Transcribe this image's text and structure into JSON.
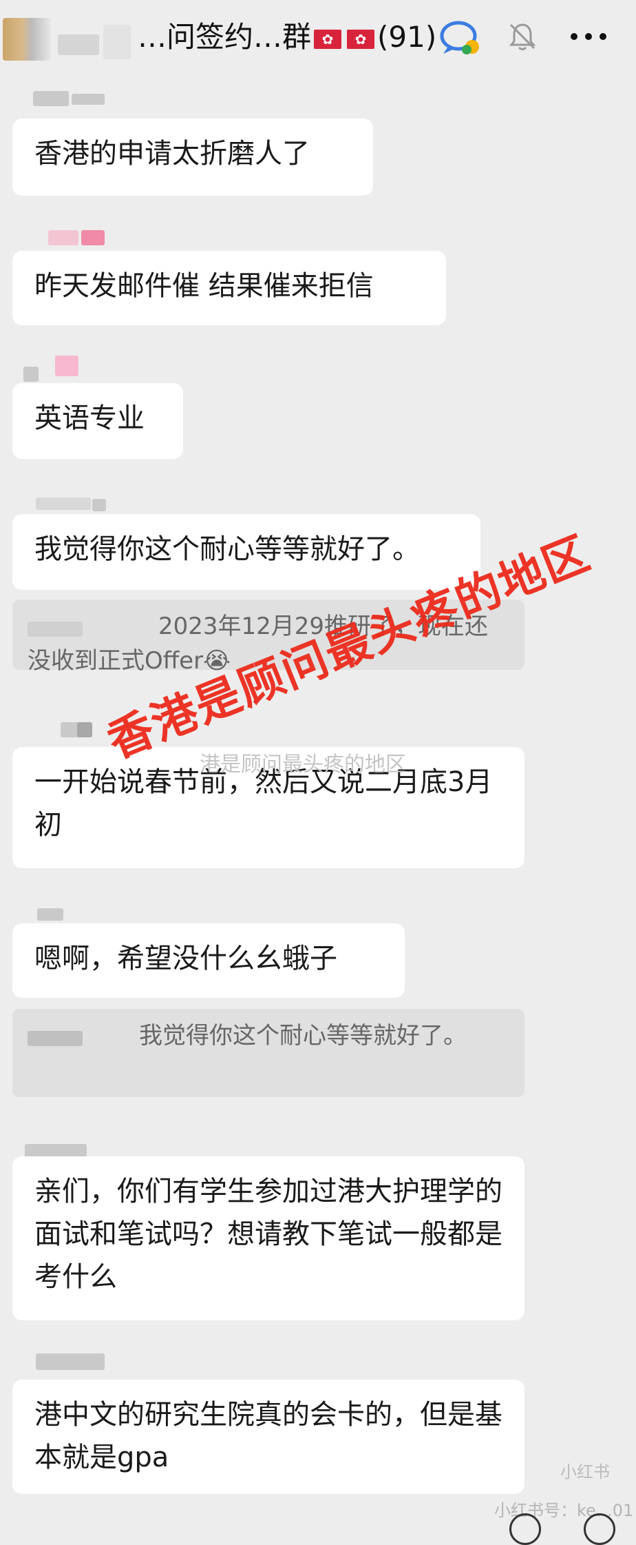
{
  "header": {
    "title": "…问签约…群",
    "member_count": "(91)"
  },
  "messages": [
    {
      "text": "香港的申请太折磨人了"
    },
    {
      "text": "昨天发邮件催 结果催来拒信"
    },
    {
      "text": "英语专业"
    },
    {
      "text": "我觉得你这个耐心等等就好了。"
    },
    {
      "text": "2023年12月29推研了，现在还没收到正式Offer😭"
    },
    {
      "text": "一开始说春节前，然后又说二月底3月初"
    },
    {
      "text": "嗯啊，希望没什么幺蛾子"
    },
    {
      "text": "我觉得你这个耐心等等就好了。"
    },
    {
      "text": "亲们，你们有学生参加过港大护理学的面试和笔试吗？想请教下笔试一般都是考什么"
    },
    {
      "text": "港中文的研究生院真的会卡的，但是基本就是gpa"
    }
  ],
  "overlay": {
    "red_text": "香港是顾问最头疼的地区",
    "faint_text": "港是顾问最头疼的地区"
  },
  "corner_mark": "小红书",
  "bottom_bar": {
    "text": "小红书号：ke…01"
  },
  "colors": {
    "background": "#ededed",
    "bubble": "#ffffff",
    "quote": "#e0e0e0",
    "overlay_red": "#ec2b1c",
    "flag_red": "#d8233c"
  },
  "icons": [
    "back-avatar",
    "hk-flag-icon",
    "chat-bubble-icon",
    "bell-off-icon",
    "more-icon",
    "emoji-icon",
    "plus-icon"
  ]
}
